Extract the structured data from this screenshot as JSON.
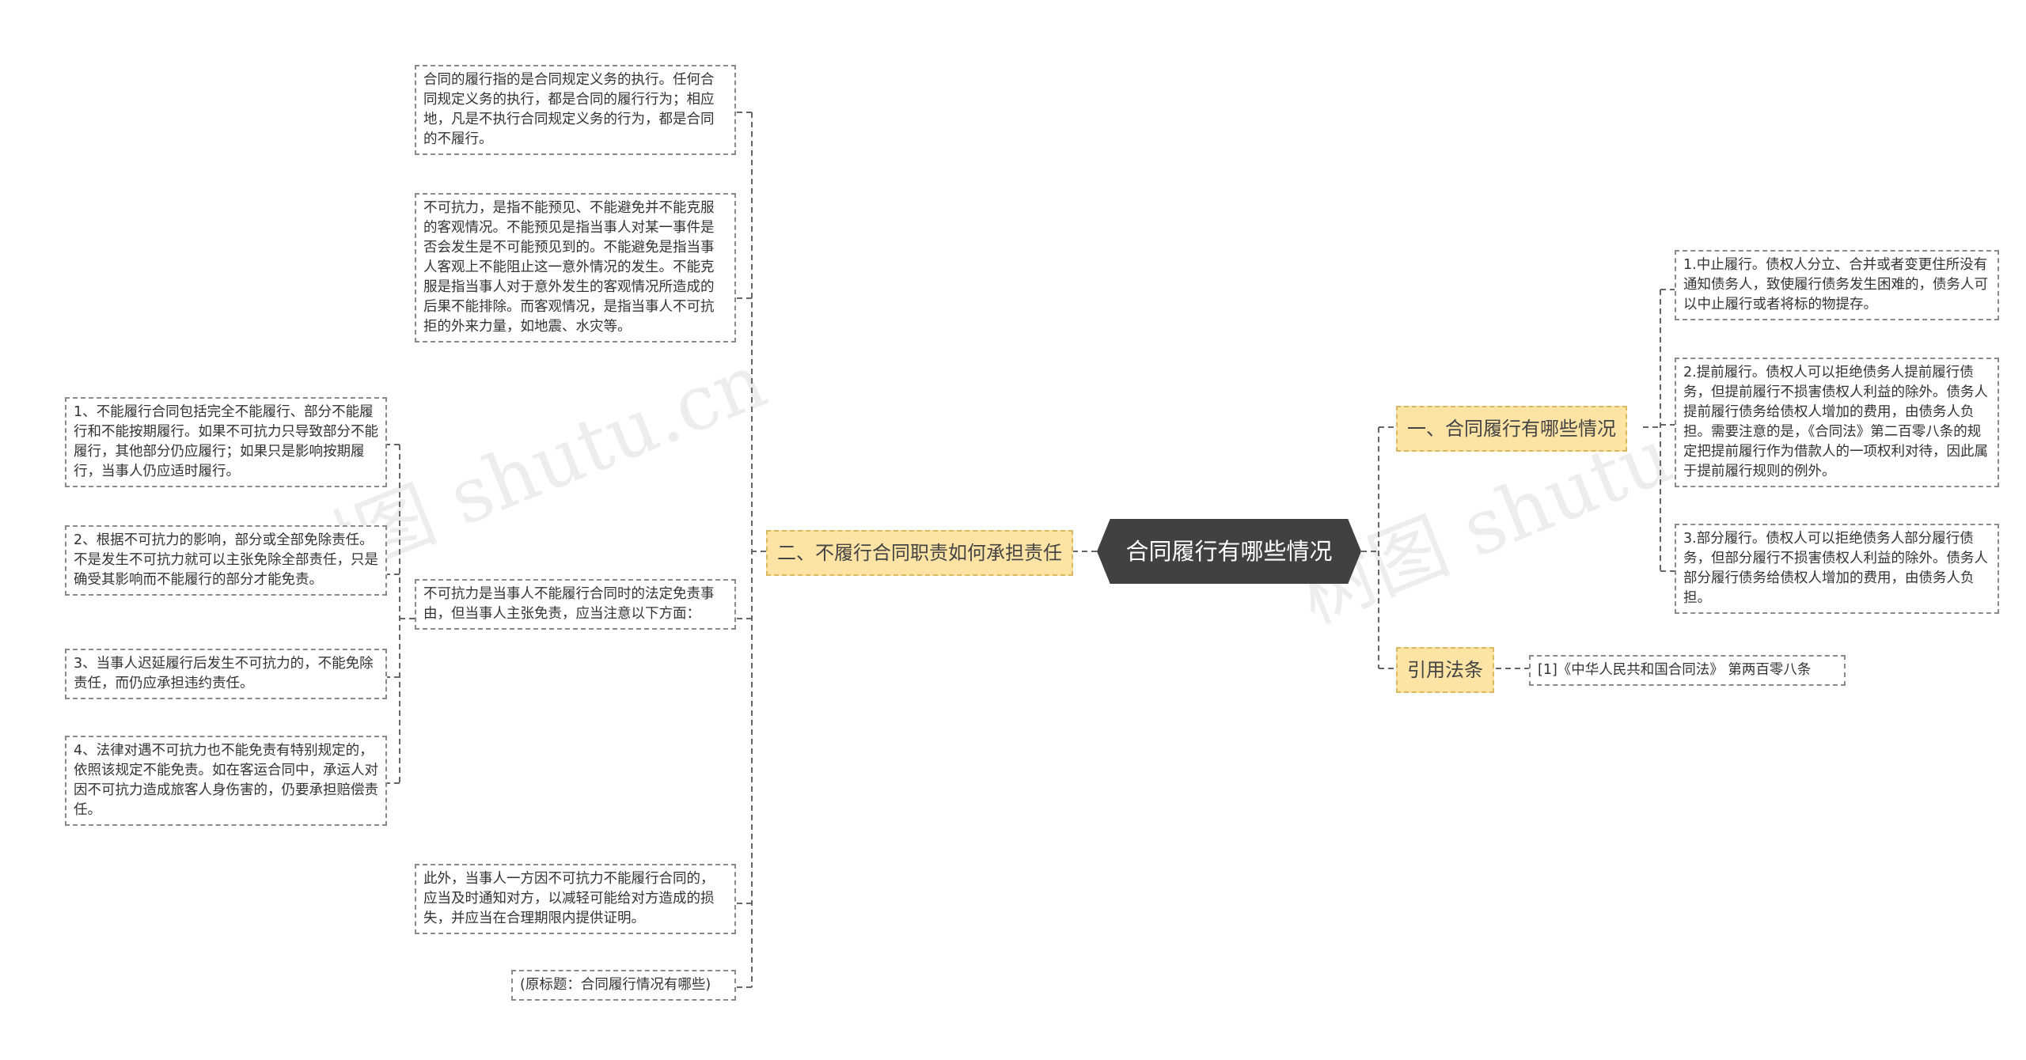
{
  "root": {
    "label": "合同履行有哪些情况"
  },
  "left_branch": {
    "label": "二、不履行合同职责如何承担责任",
    "definition": "合同的履行指的是合同规定义务的执行。任何合同规定义务的执行，都是合同的履行行为；相应地，凡是不执行合同规定义务的行为，都是合同的不履行。",
    "force_majeure": "不可抗力，是指不能预见、不能避免并不能克服的客观情况。不能预见是指当事人对某一事件是否会发生是不可能预见到的。不能避免是指当事人客观上不能阻止这一意外情况的发生。不能克服是指当事人对于意外发生的客观情况所造成的后果不能排除。而客观情况，是指当事人不可抗拒的外来力量，如地震、水灾等。",
    "exemption_reason": "不可抗力是当事人不能履行合同时的法定免责事由，但当事人主张免责，应当注意以下方面：",
    "exemption_points": [
      "1、不能履行合同包括完全不能履行、部分不能履行和不能按期履行。如果不可抗力只导致部分不能履行，其他部分仍应履行；如果只是影响按期履行，当事人仍应适时履行。",
      "2、根据不可抗力的影响，部分或全部免除责任。不是发生不可抗力就可以主张免除全部责任，只是确受其影响而不能履行的部分才能免责。",
      "3、当事人迟延履行后发生不可抗力的，不能免除责任，而仍应承担违约责任。",
      "4、法律对遇不可抗力也不能免责有特别规定的，依照该规定不能免责。如在客运合同中，承运人对因不可抗力造成旅客人身伤害的，仍要承担赔偿责任。"
    ],
    "notice": "此外，当事人一方因不可抗力不能履行合同的，应当及时通知对方，以减轻可能给对方造成的损失，并应当在合理期限内提供证明。",
    "original_title": "(原标题：合同履行情况有哪些)"
  },
  "right_branch": {
    "label": "一、合同履行有哪些情况",
    "items": [
      "1.中止履行。债权人分立、合并或者变更住所没有通知债务人，致使履行债务发生困难的，债务人可以中止履行或者将标的物提存。",
      "2.提前履行。债权人可以拒绝债务人提前履行债务，但提前履行不损害债权人利益的除外。债务人提前履行债务给债权人增加的费用，由债务人负担。需要注意的是，《合同法》第二百零八条的规定把提前履行作为借款人的一项权利对待，因此属于提前履行规则的例外。",
      "3.部分履行。债权人可以拒绝债务人部分履行债务，但部分履行不损害债权人利益的除外。债务人部分履行债务给债权人增加的费用，由债务人负担。"
    ]
  },
  "law_branch": {
    "label": "引用法条",
    "items": [
      "[1]《中华人民共和国合同法》 第两百零八条"
    ]
  },
  "colors": {
    "root_bg": "#414141",
    "branch_bg": "#fde4a5",
    "connector": "#666666",
    "node_border": "#8a8a8a"
  },
  "watermark_text": "树图 shutu.cn"
}
